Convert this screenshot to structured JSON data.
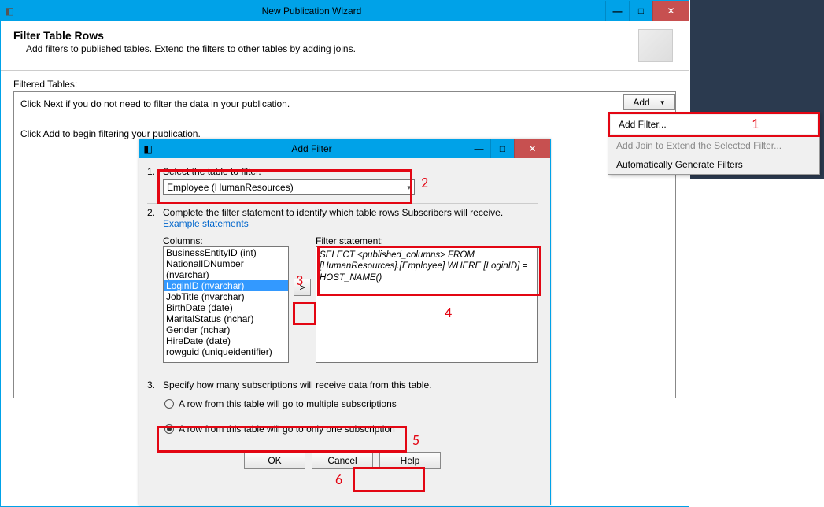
{
  "main": {
    "title": "New Publication Wizard",
    "heading": "Filter Table Rows",
    "subheading": "Add filters to published tables. Extend the filters to other tables by adding joins.",
    "filteredLabel": "Filtered Tables:",
    "filteredLine1": "Click Next if you do not need to filter the data in your publication.",
    "filteredLine2": "Click Add to begin filtering your publication.",
    "addBtn": "Add"
  },
  "popup": {
    "addFilter": "Add Filter...",
    "addJoin": "Add Join to Extend the Selected Filter...",
    "autoGen": "Automatically Generate Filters"
  },
  "numbers": {
    "n1": "1",
    "n2": "2",
    "n3": "3",
    "n4": "4",
    "n5": "5",
    "n6": "6"
  },
  "af": {
    "title": "Add Filter",
    "step1num": "1.",
    "step1": "Select the table to filter.",
    "tableSel": "Employee (HumanResources)",
    "step2num": "2.",
    "step2a": "Complete the filter statement to identify which table rows Subscribers will receive. ",
    "exampleLink": "Example statements",
    "columnsLabel": "Columns:",
    "columns": {
      "c0": "BusinessEntityID (int)",
      "c1": "NationalIDNumber (nvarchar)",
      "c2": "LoginID (nvarchar)",
      "c3": "JobTitle (nvarchar)",
      "c4": "BirthDate (date)",
      "c5": "MaritalStatus (nchar)",
      "c6": "Gender (nchar)",
      "c7": "HireDate (date)",
      "c8": "rowguid (uniqueidentifier)"
    },
    "moveBtn": ">",
    "stmtLabel": "Filter statement:",
    "stmt": "SELECT <published_columns> FROM [HumanResources].[Employee] WHERE [LoginID] = HOST_NAME()",
    "step3num": "3.",
    "step3": "Specify how many subscriptions will receive data from this table.",
    "radioMulti": "A row from this table will go to multiple subscriptions",
    "radioOne": "A row from this table will go to only one subscription",
    "ok": "OK",
    "cancel": "Cancel",
    "help": "Help"
  }
}
